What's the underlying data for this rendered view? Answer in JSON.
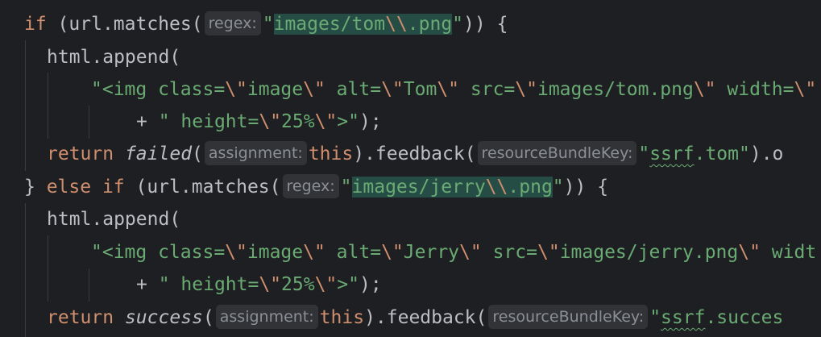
{
  "code": {
    "l1": {
      "kw": "if",
      "pre": " (url.matches(",
      "hint": "regex:",
      "q1": "\"",
      "lit": "images/tom",
      "esc": "\\\\",
      "lit2": ".png",
      "q2": "\"",
      "post": ")) {"
    },
    "l2": {
      "text": "html.append("
    },
    "l3": {
      "s1": "\"<img class=",
      "e1": "\\\"",
      "s2": "image",
      "e2": "\\\"",
      "s3": " alt=",
      "e3": "\\\"",
      "s4": "Tom",
      "e4": "\\\"",
      "s5": " src=",
      "e5": "\\\"",
      "s6": "images/tom.png",
      "e6": "\\\"",
      "s7": " width=",
      "e7": "\\\""
    },
    "l4": {
      "plus": "+ ",
      "s1": "\" height=",
      "e1": "\\\"",
      "s2": "25%",
      "e2": "\\\"",
      "s3": ">\"",
      "post": ");"
    },
    "l5": {
      "kw": "return",
      "fn": "failed",
      "p1": "(",
      "hint1": "assignment:",
      "this": "this",
      "p2": ").feedback(",
      "hint2": "resourceBundleKey:",
      "q1": "\"",
      "key": "ssrf",
      "s1": ".tom\"",
      "post": ").o"
    },
    "l6": {
      "brace": "} ",
      "kw": "else if",
      "pre": " (url.matches(",
      "hint": "regex:",
      "q1": "\"",
      "lit": "images/jerry",
      "esc": "\\\\",
      "lit2": ".png",
      "q2": "\"",
      "post": ")) {"
    },
    "l7": {
      "text": "html.append("
    },
    "l8": {
      "s1": "\"<img class=",
      "e1": "\\\"",
      "s2": "image",
      "e2": "\\\"",
      "s3": " alt=",
      "e3": "\\\"",
      "s4": "Jerry",
      "e4": "\\\"",
      "s5": " src=",
      "e5": "\\\"",
      "s6": "images/jerry.png",
      "e6": "\\\"",
      "s7": " widt"
    },
    "l9": {
      "plus": "+ ",
      "s1": "\" height=",
      "e1": "\\\"",
      "s2": "25%",
      "e2": "\\\"",
      "s3": ">\"",
      "post": ");"
    },
    "l10": {
      "kw": "return",
      "fn": "success",
      "p1": "(",
      "hint1": "assignment:",
      "this": "this",
      "p2": ").feedback(",
      "hint2": "resourceBundleKey:",
      "q1": "\"",
      "key": "ssrf",
      "s1": ".succes"
    }
  },
  "colors": {
    "background": "#1e1f22",
    "keyword": "#cf8e6d",
    "string": "#6aab73",
    "default": "#bcbec4",
    "hint": "#8c8f96",
    "highlight": "#264c46"
  }
}
